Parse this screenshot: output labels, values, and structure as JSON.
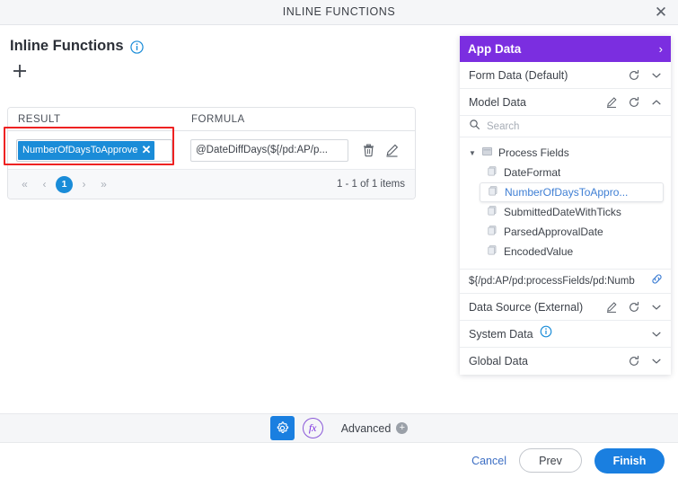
{
  "window": {
    "title": "INLINE FUNCTIONS",
    "close_label": "✕"
  },
  "main": {
    "page_title": "Inline Functions",
    "info_icon": "info-icon",
    "add_icon": "plus-icon",
    "table": {
      "columns": [
        "RESULT",
        "FORMULA"
      ],
      "rows": [
        {
          "result_chip": "NumberOfDaysToApprove",
          "chip_remove": "✕",
          "formula": "@DateDiffDays(${/pd:AP/p...",
          "actions": [
            "delete-icon",
            "edit-icon"
          ]
        }
      ],
      "pager": {
        "first": "«",
        "prev": "‹",
        "current_page": "1",
        "next": "›",
        "last": "»",
        "summary": "1 - 1 of 1 items"
      }
    }
  },
  "panel": {
    "header": {
      "title": "App Data",
      "chevron": "›"
    },
    "sections": [
      {
        "label": "Form Data (Default)",
        "has_edit": false,
        "has_refresh": true,
        "chevron": "⌄",
        "expanded": false
      },
      {
        "label": "Model Data",
        "has_edit": true,
        "has_refresh": true,
        "chevron": "⌃",
        "expanded": true
      }
    ],
    "search": {
      "placeholder": "Search",
      "value": "",
      "icon": "search-icon"
    },
    "tree": {
      "root": {
        "label": "Process Fields",
        "caret": "▼",
        "icon": "folder-icon"
      },
      "children": [
        {
          "label": "DateFormat",
          "icon": "field-icon",
          "selected": false
        },
        {
          "label": "NumberOfDaysToAppro...",
          "icon": "field-icon",
          "selected": true
        },
        {
          "label": "SubmittedDateWithTicks",
          "icon": "field-icon",
          "selected": false
        },
        {
          "label": "ParsedApprovalDate",
          "icon": "field-icon",
          "selected": false
        },
        {
          "label": "EncodedValue",
          "icon": "field-icon",
          "selected": false
        }
      ]
    },
    "path": {
      "value": "${/pd:AP/pd:processFields/pd:Numb",
      "icon": "link-icon"
    },
    "bottom_sections": [
      {
        "label": "Data Source (External)",
        "has_edit": true,
        "has_refresh": true,
        "has_info": false,
        "chevron": "⌄"
      },
      {
        "label": "System Data",
        "has_edit": false,
        "has_refresh": false,
        "has_info": true,
        "chevron": "⌄"
      },
      {
        "label": "Global Data",
        "has_edit": false,
        "has_refresh": true,
        "has_info": false,
        "chevron": "⌄"
      }
    ]
  },
  "toolbar": {
    "gear_icon": "gear-icon",
    "fx_icon": "function-icon",
    "fx_label": "fx",
    "advanced_label": "Advanced",
    "advanced_plus": "+"
  },
  "footer": {
    "cancel_label": "Cancel",
    "prev_label": "Prev",
    "finish_label": "Finish"
  },
  "colors": {
    "panel_purple": "#7b2ee0",
    "accent_blue": "#1a7fe0",
    "chip_blue": "#1a8cd8",
    "highlight_red": "#ee2222",
    "link_blue": "#3f7fd4"
  }
}
